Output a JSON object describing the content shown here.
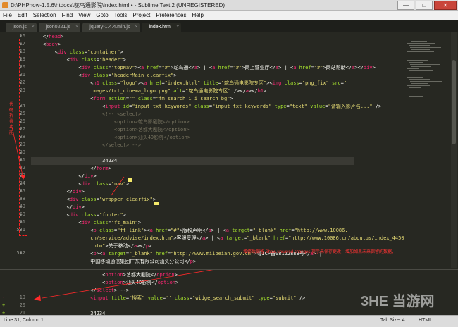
{
  "window": {
    "title": "D:\\PHPnow-1.5.6\\htdocs\\鸵鸟通影院\\index.html • - Sublime Text 2 (UNREGISTERED)",
    "controls": [
      "—",
      "□",
      "✕"
    ]
  },
  "menu": [
    "File",
    "Edit",
    "Selection",
    "Find",
    "View",
    "Goto",
    "Tools",
    "Project",
    "Preferences",
    "Help"
  ],
  "tabs": [
    {
      "label": "json.js",
      "active": false
    },
    {
      "label": "json0221.js",
      "active": false
    },
    {
      "label": "jquery-1.4.4.min.js",
      "active": false
    },
    {
      "label": "index.html",
      "active": true
    }
  ],
  "editor_top": {
    "line_numbers": [
      "16",
      "17",
      "18",
      "19",
      "20",
      "21",
      "22",
      "23",
      "",
      "24",
      "25",
      "26",
      "27",
      "28",
      "29",
      "30",
      "31",
      "32",
      "33",
      "34",
      "35",
      "48",
      "49",
      "50",
      "51",
      "531",
      "",
      "",
      "532",
      ""
    ],
    "current_line_index": 16,
    "lines": [
      [
        {
          "c": "p",
          "t": "    </"
        },
        {
          "c": "t",
          "t": "head"
        },
        {
          "c": "p",
          "t": ">"
        }
      ],
      [
        {
          "c": "p",
          "t": "    <"
        },
        {
          "c": "t",
          "t": "body"
        },
        {
          "c": "p",
          "t": ">"
        }
      ],
      [
        {
          "c": "p",
          "t": "        <"
        },
        {
          "c": "t",
          "t": "div "
        },
        {
          "c": "a",
          "t": "class"
        },
        {
          "c": "p",
          "t": "="
        },
        {
          "c": "s",
          "t": "\"container\""
        },
        {
          "c": "p",
          "t": ">"
        }
      ],
      [
        {
          "c": "p",
          "t": "            <"
        },
        {
          "c": "t",
          "t": "div "
        },
        {
          "c": "a",
          "t": "class"
        },
        {
          "c": "p",
          "t": "="
        },
        {
          "c": "s",
          "t": "\"header\""
        },
        {
          "c": "p",
          "t": ">"
        }
      ],
      [
        {
          "c": "p",
          "t": "                <"
        },
        {
          "c": "t",
          "t": "div "
        },
        {
          "c": "a",
          "t": "class"
        },
        {
          "c": "p",
          "t": "="
        },
        {
          "c": "s",
          "t": "\"topNav\""
        },
        {
          "c": "p",
          "t": "><"
        },
        {
          "c": "t",
          "t": "a "
        },
        {
          "c": "a",
          "t": "href"
        },
        {
          "c": "p",
          "t": "="
        },
        {
          "c": "s",
          "t": "\"#\""
        },
        {
          "c": "p",
          "t": ">鸵鸟通</"
        },
        {
          "c": "t",
          "t": "a"
        },
        {
          "c": "p",
          "t": "> | <"
        },
        {
          "c": "t",
          "t": "a "
        },
        {
          "c": "a",
          "t": "href"
        },
        {
          "c": "p",
          "t": "="
        },
        {
          "c": "s",
          "t": "\"#\""
        },
        {
          "c": "p",
          "t": ">网上营业厅</"
        },
        {
          "c": "t",
          "t": "a"
        },
        {
          "c": "p",
          "t": "> | <"
        },
        {
          "c": "t",
          "t": "a "
        },
        {
          "c": "a",
          "t": "href"
        },
        {
          "c": "p",
          "t": "="
        },
        {
          "c": "s",
          "t": "\"#\""
        },
        {
          "c": "p",
          "t": ">网站帮助</"
        },
        {
          "c": "t",
          "t": "a"
        },
        {
          "c": "p",
          "t": "></"
        },
        {
          "c": "t",
          "t": "div"
        },
        {
          "c": "p",
          "t": ">"
        }
      ],
      [
        {
          "c": "p",
          "t": "                <"
        },
        {
          "c": "t",
          "t": "div "
        },
        {
          "c": "a",
          "t": "class"
        },
        {
          "c": "p",
          "t": "="
        },
        {
          "c": "s",
          "t": "\"headerMain clearfix\""
        },
        {
          "c": "p",
          "t": ">"
        }
      ],
      [
        {
          "c": "p",
          "t": "                    <"
        },
        {
          "c": "t",
          "t": "h1 "
        },
        {
          "c": "a",
          "t": "class"
        },
        {
          "c": "p",
          "t": "="
        },
        {
          "c": "s",
          "t": "\"logo\""
        },
        {
          "c": "p",
          "t": "><"
        },
        {
          "c": "t",
          "t": "a "
        },
        {
          "c": "a",
          "t": "href"
        },
        {
          "c": "p",
          "t": "="
        },
        {
          "c": "s",
          "t": "\"index.html\" "
        },
        {
          "c": "a",
          "t": "title"
        },
        {
          "c": "p",
          "t": "="
        },
        {
          "c": "s",
          "t": "\"鸵鸟通电影院专区\""
        },
        {
          "c": "p",
          "t": "><"
        },
        {
          "c": "t",
          "t": "img "
        },
        {
          "c": "a",
          "t": "class"
        },
        {
          "c": "p",
          "t": "="
        },
        {
          "c": "s",
          "t": "\"png_fix\" "
        },
        {
          "c": "a",
          "t": "src"
        },
        {
          "c": "p",
          "t": "="
        },
        {
          "c": "s",
          "t": "\""
        }
      ],
      [
        {
          "c": "s",
          "t": "                    images/tct_cinema_logo.png\" "
        },
        {
          "c": "a",
          "t": "alt"
        },
        {
          "c": "p",
          "t": "="
        },
        {
          "c": "s",
          "t": "\"鸵鸟通电影院专区\""
        },
        {
          "c": "p",
          "t": " /></"
        },
        {
          "c": "t",
          "t": "a"
        },
        {
          "c": "p",
          "t": "></"
        },
        {
          "c": "t",
          "t": "h1"
        },
        {
          "c": "p",
          "t": ">"
        }
      ],
      [
        {
          "c": "p",
          "t": "                    <"
        },
        {
          "c": "t",
          "t": "form "
        },
        {
          "c": "a",
          "t": "action"
        },
        {
          "c": "p",
          "t": "="
        },
        {
          "c": "s",
          "t": "\"\" "
        },
        {
          "c": "a",
          "t": "class"
        },
        {
          "c": "p",
          "t": "="
        },
        {
          "c": "s",
          "t": "\"fm_search i i_search_bg\""
        },
        {
          "c": "p",
          "t": ">"
        }
      ],
      [
        {
          "c": "p",
          "t": "                        <"
        },
        {
          "c": "t",
          "t": "input "
        },
        {
          "c": "a",
          "t": "id"
        },
        {
          "c": "p",
          "t": "="
        },
        {
          "c": "s",
          "t": "\"input_txt_keywords\" "
        },
        {
          "c": "a",
          "t": "class"
        },
        {
          "c": "p",
          "t": "="
        },
        {
          "c": "s",
          "t": "\"input_txt_keywords\" "
        },
        {
          "c": "a",
          "t": "type"
        },
        {
          "c": "p",
          "t": "="
        },
        {
          "c": "s",
          "t": "\"text\" "
        },
        {
          "c": "a",
          "t": "value"
        },
        {
          "c": "p",
          "t": "="
        },
        {
          "c": "s",
          "t": "\"请输入影片名...\""
        },
        {
          "c": "p",
          "t": " />"
        }
      ],
      [
        {
          "c": "c",
          "t": "                        <!-- <select>"
        }
      ],
      [
        {
          "c": "c",
          "t": "                            <option>鸵鸟影剧院</option>"
        }
      ],
      [
        {
          "c": "c",
          "t": "                            <option>艺都大剧院</option>"
        }
      ],
      [
        {
          "c": "c",
          "t": "                            <option>汕头4D影院</option>"
        }
      ],
      [
        {
          "c": "c",
          "t": "                        </select> -->"
        }
      ],
      [
        {
          "c": "p",
          "t": ""
        }
      ],
      [
        {
          "c": "p",
          "t": "                        34234"
        }
      ],
      [
        {
          "c": "p",
          "t": "                    </"
        },
        {
          "c": "t",
          "t": "form"
        },
        {
          "c": "p",
          "t": ">"
        }
      ],
      [
        {
          "c": "p",
          "t": "                </"
        },
        {
          "c": "t",
          "t": "div"
        },
        {
          "c": "p",
          "t": ">"
        }
      ],
      [
        {
          "c": "p",
          "t": "                <"
        },
        {
          "c": "t",
          "t": "div "
        },
        {
          "c": "a",
          "t": "class"
        },
        {
          "c": "p",
          "t": "="
        },
        {
          "c": "s",
          "t": "\"nav\""
        },
        {
          "c": "p",
          "t": ">"
        }
      ],
      [
        {
          "c": "p",
          "t": "            </"
        },
        {
          "c": "t",
          "t": "div"
        },
        {
          "c": "p",
          "t": ">"
        }
      ],
      [
        {
          "c": "p",
          "t": "            <"
        },
        {
          "c": "t",
          "t": "div "
        },
        {
          "c": "a",
          "t": "class"
        },
        {
          "c": "p",
          "t": "="
        },
        {
          "c": "s",
          "t": "\"wrapper clearfix\""
        },
        {
          "c": "p",
          "t": ">"
        }
      ],
      [
        {
          "c": "p",
          "t": "            </"
        },
        {
          "c": "t",
          "t": "div"
        },
        {
          "c": "p",
          "t": ">"
        }
      ],
      [
        {
          "c": "p",
          "t": "            <"
        },
        {
          "c": "t",
          "t": "div "
        },
        {
          "c": "a",
          "t": "class"
        },
        {
          "c": "p",
          "t": "="
        },
        {
          "c": "s",
          "t": "\"footer\""
        },
        {
          "c": "p",
          "t": ">"
        }
      ],
      [
        {
          "c": "p",
          "t": "                <"
        },
        {
          "c": "t",
          "t": "div "
        },
        {
          "c": "a",
          "t": "class"
        },
        {
          "c": "p",
          "t": "="
        },
        {
          "c": "s",
          "t": "\"ft_main\""
        },
        {
          "c": "p",
          "t": ">"
        }
      ],
      [
        {
          "c": "p",
          "t": "                    <"
        },
        {
          "c": "t",
          "t": "p "
        },
        {
          "c": "a",
          "t": "class"
        },
        {
          "c": "p",
          "t": "="
        },
        {
          "c": "s",
          "t": "\"ft_link\""
        },
        {
          "c": "p",
          "t": "><"
        },
        {
          "c": "t",
          "t": "a "
        },
        {
          "c": "a",
          "t": "href"
        },
        {
          "c": "p",
          "t": "="
        },
        {
          "c": "s",
          "t": "\"#\""
        },
        {
          "c": "p",
          "t": ">版权声明</"
        },
        {
          "c": "t",
          "t": "a"
        },
        {
          "c": "p",
          "t": "> | <"
        },
        {
          "c": "t",
          "t": "a "
        },
        {
          "c": "a",
          "t": "target"
        },
        {
          "c": "p",
          "t": "="
        },
        {
          "c": "s",
          "t": "\"_blank\" "
        },
        {
          "c": "a",
          "t": "href"
        },
        {
          "c": "p",
          "t": "="
        },
        {
          "c": "s",
          "t": "\"http://www.10086."
        }
      ],
      [
        {
          "c": "s",
          "t": "                    cn/service/advise/index.htm\""
        },
        {
          "c": "p",
          "t": ">客服受理</"
        },
        {
          "c": "t",
          "t": "a"
        },
        {
          "c": "p",
          "t": "> | <"
        },
        {
          "c": "t",
          "t": "a "
        },
        {
          "c": "a",
          "t": "target"
        },
        {
          "c": "p",
          "t": "="
        },
        {
          "c": "s",
          "t": "\"_blank\" "
        },
        {
          "c": "a",
          "t": "href"
        },
        {
          "c": "p",
          "t": "="
        },
        {
          "c": "s",
          "t": "\"http://www.10086.cn/aboutus/index_4450"
        }
      ],
      [
        {
          "c": "s",
          "t": "                    .htm\""
        },
        {
          "c": "p",
          "t": ">关于移动</"
        },
        {
          "c": "t",
          "t": "a"
        },
        {
          "c": "p",
          "t": "></"
        },
        {
          "c": "t",
          "t": "p"
        },
        {
          "c": "p",
          "t": ">"
        }
      ],
      [
        {
          "c": "p",
          "t": "                    <"
        },
        {
          "c": "t",
          "t": "p"
        },
        {
          "c": "p",
          "t": "><"
        },
        {
          "c": "t",
          "t": "a "
        },
        {
          "c": "a",
          "t": "target"
        },
        {
          "c": "p",
          "t": "="
        },
        {
          "c": "s",
          "t": "\"_blank\" "
        },
        {
          "c": "a",
          "t": "href"
        },
        {
          "c": "p",
          "t": "="
        },
        {
          "c": "s",
          "t": "\"http://www.miibeian.gov.cn\""
        },
        {
          "c": "p",
          "t": ">粤ICP备08122883号</"
        },
        {
          "c": "t",
          "t": "a"
        },
        {
          "c": "p",
          "t": "> |"
        }
      ],
      [
        {
          "c": "p",
          "t": "                    中国移动通信集团广东有限公司汕头分公司</"
        },
        {
          "c": "t",
          "t": "p"
        },
        {
          "c": "p",
          "t": ">"
        }
      ]
    ]
  },
  "editor_bottom": {
    "line_numbers": [
      "",
      "",
      "",
      "19",
      "20",
      "21",
      "",
      ""
    ],
    "markers": [
      "",
      "",
      "",
      "-",
      "+",
      "+",
      "",
      ""
    ],
    "lines": [
      [
        {
          "c": "p",
          "t": "                        <"
        },
        {
          "c": "t",
          "t": "option"
        },
        {
          "c": "p",
          "t": ">艺都大剧院</"
        },
        {
          "c": "t",
          "t": "option"
        },
        {
          "c": "p",
          "t": ">"
        }
      ],
      [
        {
          "c": "p",
          "t": "                        <"
        },
        {
          "c": "t",
          "t": "option"
        },
        {
          "c": "p",
          "t": ">汕头4D影院</"
        },
        {
          "c": "t",
          "t": "option"
        },
        {
          "c": "p",
          "t": ">"
        }
      ],
      [
        {
          "c": "p",
          "t": "                    </"
        },
        {
          "c": "t",
          "t": "select"
        },
        {
          "c": "p",
          "t": "> -->"
        }
      ],
      [
        {
          "c": "t",
          "t": "                    <input "
        },
        {
          "c": "a",
          "t": "title"
        },
        {
          "c": "p",
          "t": "="
        },
        {
          "c": "s",
          "t": "\"搜索\" "
        },
        {
          "c": "a",
          "t": "value"
        },
        {
          "c": "p",
          "t": "="
        },
        {
          "c": "s",
          "t": "'' "
        },
        {
          "c": "a",
          "t": "class"
        },
        {
          "c": "p",
          "t": "="
        },
        {
          "c": "s",
          "t": "\"widge_search_submit\" "
        },
        {
          "c": "a",
          "t": "type"
        },
        {
          "c": "p",
          "t": "="
        },
        {
          "c": "s",
          "t": "\"submit\""
        },
        {
          "c": "p",
          "t": " />"
        }
      ],
      [
        {
          "c": "p",
          "t": ""
        }
      ],
      [
        {
          "c": "p",
          "t": "                    34234"
        }
      ],
      [
        {
          "c": "p",
          "t": ""
        }
      ],
      [
        {
          "c": "p",
          "t": ""
        }
      ]
    ]
  },
  "annotations": {
    "left_note": "代码折叠功能",
    "right_note": "增修后保留 Show unsaved changes 提示未保存更改，增加如果未来保留的数据，"
  },
  "status": {
    "position": "Line 31, Column 1",
    "tab_size": "Tab Size: 4",
    "syntax": "HTML"
  },
  "watermark": "3HE 当游网",
  "colors": {
    "background": "#272822",
    "tag": "#f92672",
    "attribute": "#a6e22e",
    "string": "#e6db74",
    "comment": "#75715e",
    "annotation": "#ff3333"
  }
}
